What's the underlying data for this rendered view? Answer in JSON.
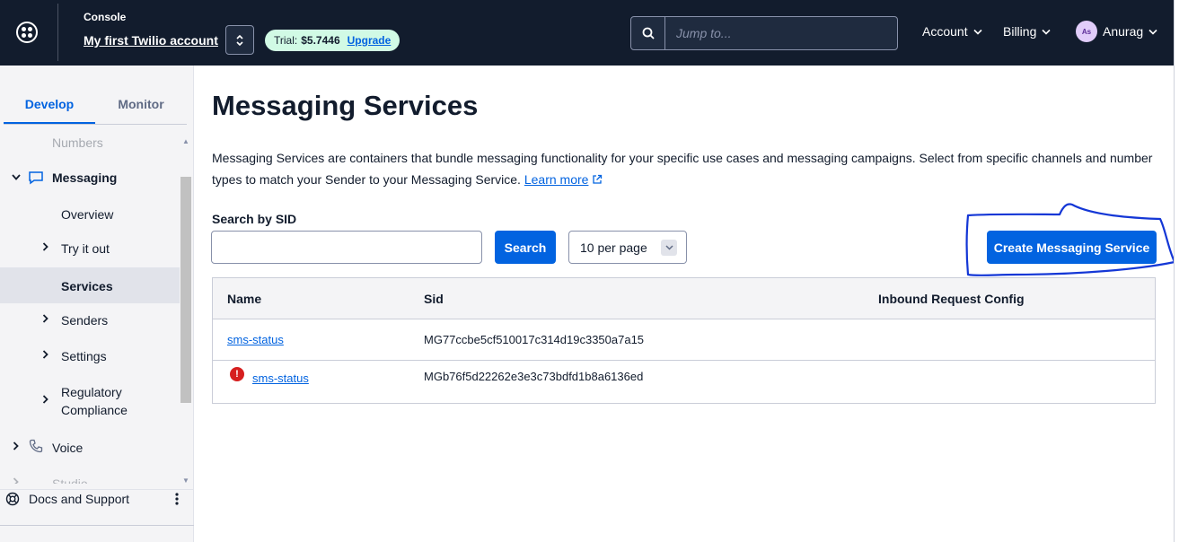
{
  "header": {
    "console_label": "Console",
    "account_name": "My first Twilio account",
    "trial_label": "Trial:",
    "trial_balance": "$5.7446",
    "upgrade_label": "Upgrade",
    "search_placeholder": "Jump to...",
    "account_menu": "Account",
    "billing_menu": "Billing",
    "user_initials": "As",
    "user_name": "Anurag"
  },
  "sidebar": {
    "tabs": [
      {
        "label": "Develop",
        "active": true
      },
      {
        "label": "Monitor",
        "active": false
      }
    ],
    "items": [
      {
        "label": "Numbers"
      },
      {
        "label": "Messaging",
        "expanded": true
      },
      {
        "label": "Overview"
      },
      {
        "label": "Try it out"
      },
      {
        "label": "Services",
        "active": true
      },
      {
        "label": "Senders"
      },
      {
        "label": "Settings"
      },
      {
        "label": "Regulatory"
      },
      {
        "label": "Compliance"
      },
      {
        "label": "Voice"
      },
      {
        "label": "Studio"
      }
    ],
    "docs_label": "Docs and Support"
  },
  "main": {
    "title": "Messaging Services",
    "description": "Messaging Services are containers that bundle messaging functionality for your specific use cases and messaging campaigns. Select from specific channels and number types to match your Sender to your Messaging Service.",
    "learn_more": "Learn more",
    "search_label": "Search by SID",
    "search_value": "",
    "search_button": "Search",
    "per_page": "10 per page",
    "create_button": "Create Messaging Service",
    "table": {
      "headers": [
        "Name",
        "Sid",
        "Inbound Request Config"
      ],
      "rows": [
        {
          "name": "sms-status",
          "sid": "MG77ccbe5cf510017c314d19c3350a7a15",
          "config": "",
          "error": false
        },
        {
          "name": "sms-status",
          "sid": "MGb76f5d22262e3e3c73bdfd1b8a6136ed",
          "config": "",
          "error": true
        }
      ]
    }
  },
  "colors": {
    "topbar": "#121c2d",
    "primary": "#0263e0",
    "trial_bg": "#d1fae5",
    "error": "#d61f1f",
    "annotation": "#1437d6"
  }
}
